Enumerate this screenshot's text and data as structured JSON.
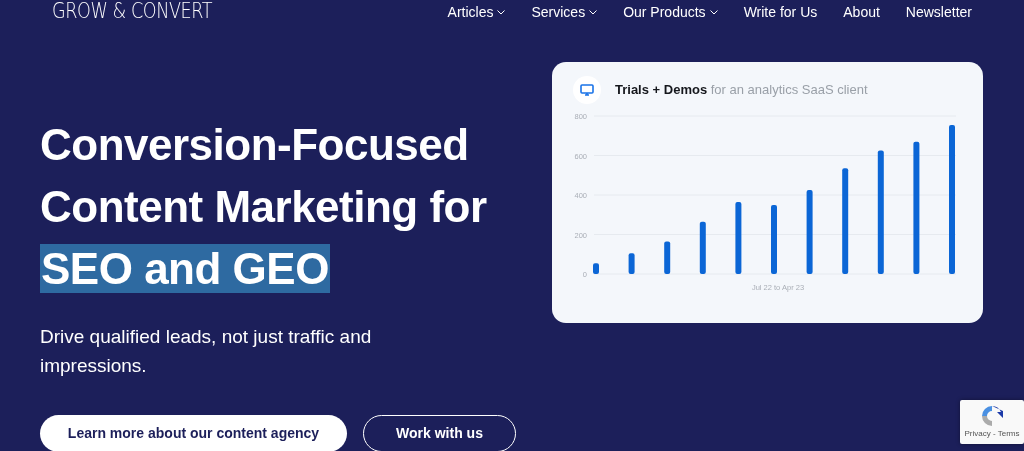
{
  "header": {
    "logo": "GROW & CONVERT",
    "nav": [
      {
        "label": "Articles",
        "dropdown": true
      },
      {
        "label": "Services",
        "dropdown": true
      },
      {
        "label": "Our Products",
        "dropdown": true
      },
      {
        "label": "Write for Us",
        "dropdown": false
      },
      {
        "label": "About",
        "dropdown": false
      },
      {
        "label": "Newsletter",
        "dropdown": false
      }
    ]
  },
  "hero": {
    "headline": "Conversion-Focused Content Marketing for",
    "headline_highlight": "SEO and GEO",
    "subtitle": "Drive qualified leads, not just traffic and impressions.",
    "buttons": [
      {
        "label": "Learn more about our content agency",
        "kind": "primary"
      },
      {
        "label": "Work with us",
        "kind": "outline"
      }
    ]
  },
  "chart_card": {
    "title": "**Trials + Demos** for an analytics SaaS client",
    "chart_data": {
      "type": "bar",
      "grid": true,
      "xlabel": "Jul 22 to Apr 23",
      "ylim": [
        0,
        800
      ],
      "yticks": [
        0,
        200,
        400,
        600,
        800
      ],
      "series": [
        {
          "color": "#0b66d6",
          "values": [
            55,
            105,
            165,
            265,
            365,
            350,
            425,
            535,
            625,
            670,
            755
          ]
        }
      ]
    }
  },
  "recaptcha": {
    "links": "Privacy - Terms"
  }
}
